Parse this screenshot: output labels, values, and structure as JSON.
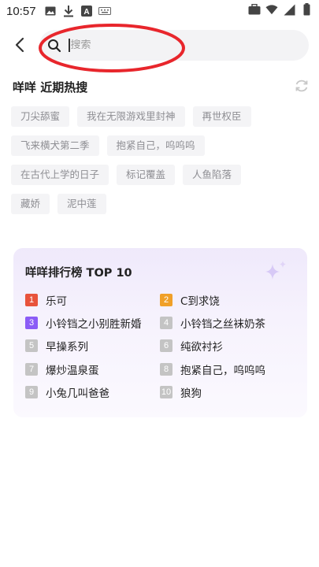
{
  "status_bar": {
    "time": "10:57",
    "left_icons": [
      "image-icon",
      "download-icon",
      "font-icon",
      "keyboard-icon"
    ],
    "right_icons": [
      "briefcase-icon",
      "wifi-icon",
      "signal-icon",
      "battery-icon"
    ]
  },
  "search": {
    "placeholder": "搜索",
    "value": ""
  },
  "hot": {
    "title": "咩咩 近期热搜",
    "tags": [
      [
        "刀尖舔蜜",
        "我在无限游戏里封神",
        "再世权臣"
      ],
      [
        "飞来横犬第二季",
        "抱紧自己，呜呜呜"
      ],
      [
        "在古代上学的日子",
        "标记覆盖",
        "人鱼陷落"
      ],
      [
        "藏娇",
        "泥中莲"
      ]
    ]
  },
  "ranking": {
    "title": "咩咩排行榜 TOP 10",
    "items": [
      {
        "rank": "1",
        "label": "乐可",
        "color": "#e8533b"
      },
      {
        "rank": "2",
        "label": "C到求饶",
        "color": "#f0a028"
      },
      {
        "rank": "3",
        "label": "小铃铛之小别胜新婚",
        "color": "#8b5cf6"
      },
      {
        "rank": "4",
        "label": "小铃铛之丝袜奶茶",
        "color": "#c4c4c4"
      },
      {
        "rank": "5",
        "label": "早操系列",
        "color": "#c4c4c4"
      },
      {
        "rank": "6",
        "label": "纯欲衬衫",
        "color": "#c4c4c4"
      },
      {
        "rank": "7",
        "label": "爆炒温泉蛋",
        "color": "#c4c4c4"
      },
      {
        "rank": "8",
        "label": "抱紧自己，呜呜呜",
        "color": "#c4c4c4"
      },
      {
        "rank": "9",
        "label": "小兔几叫爸爸",
        "color": "#c4c4c4"
      },
      {
        "rank": "10",
        "label": "狼狗",
        "color": "#c4c4c4"
      }
    ]
  },
  "colors": {
    "annotation": "#e8262c",
    "accent_purple": "#8b5cf6"
  }
}
